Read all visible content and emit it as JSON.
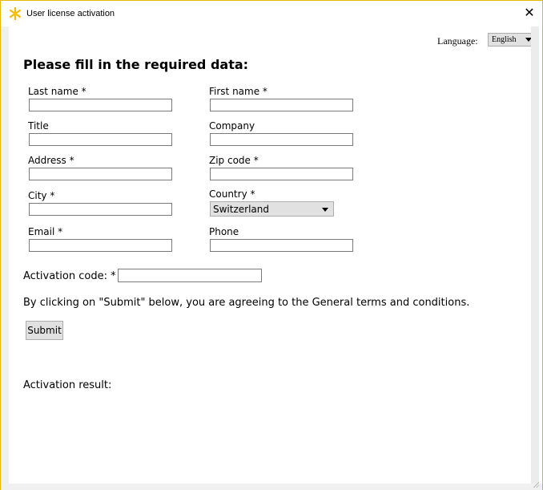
{
  "window": {
    "title": "User license activation",
    "close_glyph": "✕",
    "icon": "star-burst-icon",
    "accent_color": "#e6b800"
  },
  "language": {
    "label": "Language:",
    "selected": "English"
  },
  "form": {
    "heading": "Please fill in the required data:",
    "fields": {
      "last_name": {
        "label": "Last name *",
        "value": ""
      },
      "first_name": {
        "label": "First name *",
        "value": ""
      },
      "title": {
        "label": "Title",
        "value": ""
      },
      "company": {
        "label": "Company",
        "value": ""
      },
      "address": {
        "label": "Address *",
        "value": ""
      },
      "zip_code": {
        "label": "Zip code *",
        "value": ""
      },
      "city": {
        "label": "City *",
        "value": ""
      },
      "country": {
        "label": "Country *",
        "selected": "Switzerland"
      },
      "email": {
        "label": "Email *",
        "value": ""
      },
      "phone": {
        "label": "Phone",
        "value": ""
      }
    },
    "activation_code": {
      "label": "Activation code: *",
      "value": ""
    },
    "terms_text": "By clicking on \"Submit\" below, you are agreeing to the General terms and conditions.",
    "submit_label": "Submit",
    "result_label": "Activation result:"
  }
}
